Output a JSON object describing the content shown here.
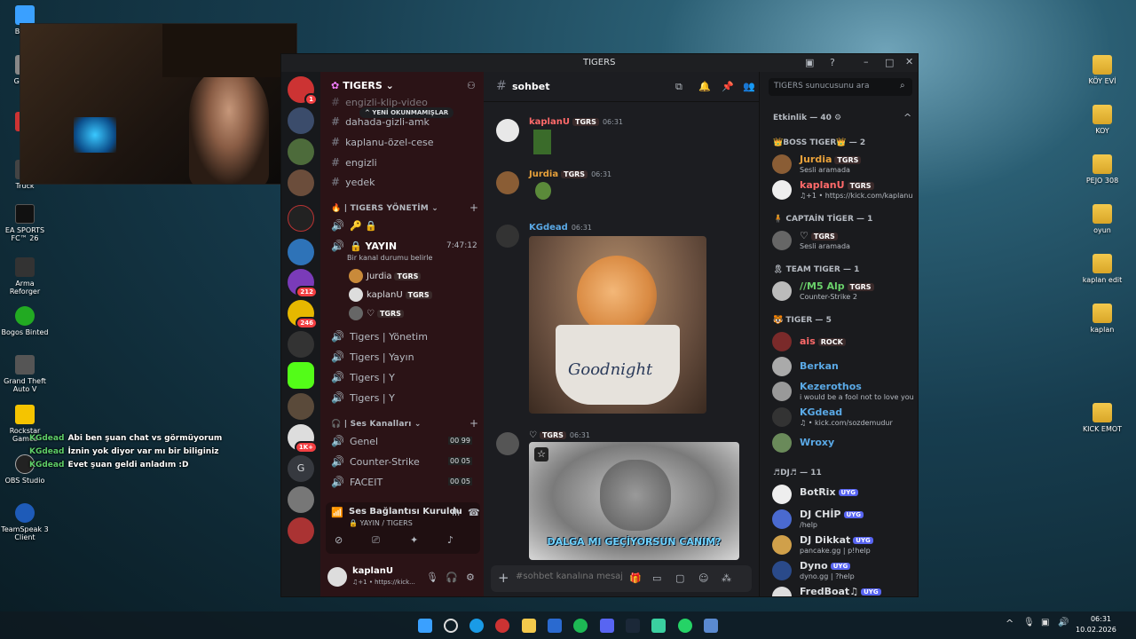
{
  "desktop_icons": [
    {
      "label": "Bu bil",
      "color": "#3aa0ff"
    },
    {
      "label": "G Don",
      "color": "#888"
    },
    {
      "label": "B",
      "color": "#c33"
    },
    {
      "label": "Truck",
      "color": "#444"
    },
    {
      "label": "EA SPORTS FC™ 26",
      "color": "#111"
    },
    {
      "label": "Arma Reforger",
      "color": "#333"
    },
    {
      "label": "Bogos Binted",
      "color": "#2a2"
    },
    {
      "label": "Grand Theft Auto V",
      "color": "#555"
    },
    {
      "label": "Rockstar Games",
      "color": "#f5c400"
    },
    {
      "label": "OBS Studio",
      "color": "#222"
    },
    {
      "label": "TeamSpeak 3 Client",
      "color": "#1e5bb8"
    }
  ],
  "desktop_folders": [
    "KÖY EVİ",
    "KOY",
    "PEJO 308",
    "oyun",
    "kaplan edit",
    "kaplan",
    "KICK EMOT"
  ],
  "stream_chat": [
    {
      "user": "KGdead",
      "text": "Abi ben şuan chat vs görmüyorum"
    },
    {
      "user": "KGdead",
      "text": "İznin yok diyor var mı bir biliginiz"
    },
    {
      "user": "KGdead",
      "text": "Evet şuan geldi anladım :D"
    }
  ],
  "window": {
    "title": "TIGERS"
  },
  "servers": {
    "badges": [
      "1",
      "212",
      "246",
      "1K+"
    ],
    "letter": "G"
  },
  "server_header": {
    "name": "TIGERS"
  },
  "unread_pill": "YENİ OKUNMAMIŞLAR",
  "text_channels": [
    "engizli-klip-video",
    "dahada-gizli-amk",
    "kaplanu-özel-cese",
    "engizli",
    "yedek"
  ],
  "category_management": "| TIGERS YÖNETİM",
  "voice_emojis": "🔑 🔒",
  "live_channel": {
    "name": "YAYIN",
    "timer": "7:47:12",
    "status": "Bir kanal durumu belirle"
  },
  "voice_users": [
    {
      "name": "Jurdia",
      "tag": "TGRS",
      "color": "#c98a3a"
    },
    {
      "name": "kaplanU",
      "tag": "TGRS",
      "color": "#ddd"
    },
    {
      "name": "♡",
      "tag": "TGRS",
      "color": "#666"
    }
  ],
  "voice_channels": [
    "Tigers | Yönetim",
    "Tigers | Yayın",
    "Tigers | Y",
    "Tigers | Y"
  ],
  "category_voice": "| Ses Kanalları",
  "voice_list": [
    {
      "name": "Genel",
      "a": "00",
      "b": "99"
    },
    {
      "name": "Counter-Strike",
      "a": "00",
      "b": "05"
    },
    {
      "name": "FACEIT",
      "a": "00",
      "b": "05"
    }
  ],
  "voice_status": {
    "title": "Ses Bağlantısı Kuruldu",
    "sub": "YAYIN / TIGERS"
  },
  "user_panel": {
    "name": "kaplanU",
    "status": "♫+1 • https://kick..."
  },
  "chat_header": {
    "channel": "sohbet"
  },
  "messages": [
    {
      "name": "kaplanU",
      "tag": "TGRS",
      "time": "06:31",
      "color": "#ff6a6a"
    },
    {
      "name": "Jurdia",
      "tag": "TGRS",
      "time": "06:31",
      "color": "#e8a13a"
    },
    {
      "name": "KGdead",
      "tag": "",
      "time": "06:31",
      "color": "#5aa9e6"
    },
    {
      "name": "♡",
      "tag": "TGRS",
      "time": "06:31",
      "color": "#dbdee1"
    }
  ],
  "image_texts": {
    "goodnight": "Goodnight",
    "meme": "DALGA MI GEÇİYORSUN CANIM?"
  },
  "composer": {
    "placeholder": "#sohbet kanalına mesaj..."
  },
  "member_search": {
    "placeholder": "TIGERS sunucusunu ara"
  },
  "members": {
    "activity": "Etkinlik — 40",
    "groups": [
      {
        "title": "👑BOSS TIGER👑 — 2",
        "items": [
          {
            "name": "Jurdia",
            "tag": "TGRS",
            "sub": "Sesli aramada",
            "color": "#e8a13a"
          },
          {
            "name": "kaplanU",
            "tag": "TGRS",
            "sub": "♫+1 • https://kick.com/kaplanu",
            "color": "#ff6a6a"
          }
        ]
      },
      {
        "title": "CAPTAİN TİGER — 1",
        "items": [
          {
            "name": "♡",
            "tag": "TGRS",
            "sub": "Sesli aramada",
            "color": "#dbdee1"
          }
        ]
      },
      {
        "title": "TEAM TIGER — 1",
        "items": [
          {
            "name": "//M5 Alp",
            "tag": "TGRS",
            "sub": "Counter-Strike 2",
            "color": "#6ad06a"
          }
        ]
      },
      {
        "title": "TIGER — 5",
        "items": [
          {
            "name": "ais",
            "tag": "ROCK",
            "sub": "",
            "color": "#ff6a6a"
          },
          {
            "name": "Berkan",
            "tag": "",
            "sub": "",
            "color": "#5aa9e6"
          },
          {
            "name": "Kezerothos",
            "tag": "",
            "sub": "i would be a fool not to love you",
            "color": "#5aa9e6"
          },
          {
            "name": "KGdead",
            "tag": "",
            "sub": "♫ • kick.com/sozdemudur",
            "color": "#5aa9e6"
          },
          {
            "name": "Wroxy",
            "tag": "",
            "sub": "",
            "color": "#5aa9e6"
          }
        ]
      },
      {
        "title": "♬DJ♬ — 11",
        "items": [
          {
            "name": "BotRix",
            "tag": "UYG",
            "sub": "",
            "color": "#dbdee1"
          },
          {
            "name": "DJ CHİP",
            "tag": "UYG",
            "sub": "/help",
            "color": "#dbdee1"
          },
          {
            "name": "DJ Dikkat",
            "tag": "UYG",
            "sub": "pancake.gg | p!help",
            "color": "#dbdee1"
          },
          {
            "name": "Dyno",
            "tag": "UYG",
            "sub": "dyno.gg | ?help",
            "color": "#dbdee1"
          },
          {
            "name": "FredBoat♫",
            "tag": "UYG",
            "sub": "",
            "color": "#dbdee1"
          }
        ]
      }
    ]
  },
  "clock": {
    "time": "06:31",
    "date": "10.02.2026"
  }
}
